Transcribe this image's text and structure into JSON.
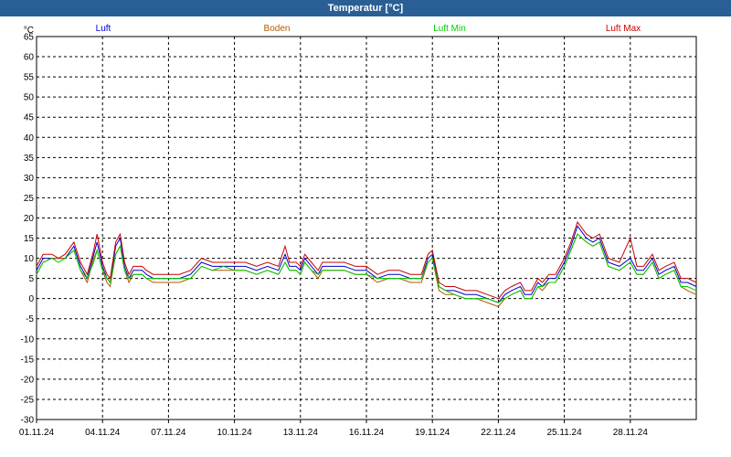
{
  "window": {
    "title": "Temperatur [°C]"
  },
  "chart_data": {
    "type": "line",
    "title": "Temperatur [°C]",
    "ylabel": "°C",
    "ylim": [
      -30,
      65
    ],
    "yticks": [
      65,
      60,
      55,
      50,
      45,
      40,
      35,
      30,
      25,
      20,
      15,
      10,
      5,
      0,
      -5,
      -10,
      -15,
      -20,
      -25,
      -30
    ],
    "xlim": [
      0,
      30
    ],
    "xticks": [
      {
        "day": 0,
        "label": "01.11.24"
      },
      {
        "day": 3,
        "label": "04.11.24"
      },
      {
        "day": 6,
        "label": "07.11.24"
      },
      {
        "day": 9,
        "label": "10.11.24"
      },
      {
        "day": 12,
        "label": "13.11.24"
      },
      {
        "day": 15,
        "label": "16.11.24"
      },
      {
        "day": 18,
        "label": "19.11.24"
      },
      {
        "day": 21,
        "label": "22.11.24"
      },
      {
        "day": 24,
        "label": "25.11.24"
      },
      {
        "day": 27,
        "label": "28.11.24"
      }
    ],
    "grid": true,
    "legend_position": "top",
    "x": [
      0,
      0.3,
      0.7,
      1,
      1.3,
      1.7,
      2,
      2.3,
      2.6,
      2.75,
      3,
      3.2,
      3.35,
      3.6,
      3.8,
      4,
      4.2,
      4.4,
      4.6,
      4.8,
      5,
      5.3,
      5.6,
      6,
      6.5,
      7,
      7.5,
      8,
      8.5,
      9,
      9.5,
      10,
      10.5,
      11,
      11.3,
      11.5,
      11.8,
      12,
      12.2,
      12.5,
      12.8,
      13,
      13.3,
      13.6,
      14,
      14.5,
      15,
      15.5,
      16,
      16.5,
      17,
      17.5,
      17.8,
      18,
      18.3,
      18.6,
      19,
      19.5,
      20,
      20.5,
      21,
      21.3,
      21.6,
      22,
      22.2,
      22.5,
      22.8,
      23,
      23.3,
      23.6,
      24,
      24.3,
      24.6,
      25,
      25.3,
      25.6,
      26,
      26.5,
      27,
      27.3,
      27.6,
      28,
      28.3,
      28.6,
      29,
      29.3,
      29.6,
      30
    ],
    "series": [
      {
        "name": "Luft",
        "color": "#0000cc",
        "values": [
          7,
          10,
          10,
          10,
          10,
          13,
          8,
          5,
          11,
          14,
          8,
          5,
          4,
          13,
          15,
          8,
          5,
          7,
          7,
          7,
          6,
          5,
          5,
          5,
          5,
          6,
          9,
          8,
          8,
          8,
          8,
          7,
          8,
          7,
          11,
          8,
          8,
          7,
          10,
          8,
          6,
          8,
          8,
          8,
          8,
          7,
          7,
          5,
          6,
          6,
          5,
          5,
          10,
          11,
          3,
          2,
          2,
          1,
          1,
          0,
          -1,
          1,
          2,
          3,
          1,
          1,
          4,
          3,
          5,
          5,
          9,
          13,
          18,
          15,
          14,
          15,
          9,
          8,
          10,
          7,
          7,
          10,
          6,
          7,
          8,
          4,
          4,
          3,
          7,
          2
        ]
      },
      {
        "name": "Boden",
        "color": "#b05a00",
        "values": [
          6,
          9,
          10,
          10,
          10,
          12,
          7,
          4,
          10,
          12,
          7,
          4,
          3,
          11,
          13,
          7,
          4,
          6,
          6,
          6,
          5,
          4,
          4,
          4,
          4,
          5,
          8,
          7,
          7,
          7,
          7,
          6,
          7,
          6,
          9,
          7,
          7,
          6,
          9,
          7,
          5,
          7,
          7,
          7,
          7,
          6,
          6,
          4,
          5,
          5,
          4,
          4,
          9,
          10,
          2,
          1,
          1,
          0,
          0,
          -1,
          -2,
          0,
          1,
          2,
          0,
          0,
          3,
          2,
          4,
          4,
          8,
          12,
          16,
          14,
          13,
          14,
          8,
          7,
          9,
          6,
          6,
          9,
          5,
          6,
          7,
          3,
          2,
          1,
          5,
          1
        ]
      },
      {
        "name": "Luft Min",
        "color": "#00cc00",
        "values": [
          6,
          9,
          10,
          9,
          10,
          12,
          7,
          5,
          9,
          12,
          7,
          5,
          4,
          11,
          13,
          7,
          5,
          6,
          6,
          6,
          5,
          5,
          5,
          5,
          5,
          5,
          8,
          7,
          8,
          7,
          7,
          6,
          7,
          6,
          9,
          7,
          7,
          6,
          9,
          7,
          6,
          7,
          7,
          7,
          7,
          6,
          6,
          5,
          5,
          5,
          5,
          5,
          9,
          10,
          3,
          2,
          1,
          0,
          0,
          0,
          -1,
          0,
          1,
          2,
          0,
          0,
          3,
          3,
          4,
          4,
          8,
          12,
          16,
          14,
          13,
          14,
          8,
          7,
          9,
          6,
          6,
          9,
          5,
          6,
          7,
          3,
          3,
          2,
          6,
          1
        ]
      },
      {
        "name": "Luft Max",
        "color": "#cc0000",
        "values": [
          8,
          11,
          11,
          10,
          11,
          14,
          9,
          6,
          12,
          16,
          9,
          6,
          5,
          14,
          16,
          9,
          6,
          8,
          8,
          8,
          7,
          6,
          6,
          6,
          6,
          7,
          10,
          9,
          9,
          9,
          9,
          8,
          9,
          8,
          13,
          9,
          9,
          8,
          11,
          9,
          7,
          9,
          9,
          9,
          9,
          8,
          8,
          6,
          7,
          7,
          6,
          6,
          11,
          12,
          4,
          3,
          3,
          2,
          2,
          1,
          0,
          2,
          3,
          4,
          2,
          2,
          5,
          4,
          6,
          6,
          10,
          14,
          19,
          16,
          15,
          16,
          10,
          9,
          15,
          8,
          8,
          11,
          7,
          8,
          9,
          5,
          5,
          4,
          8,
          3
        ]
      }
    ]
  }
}
